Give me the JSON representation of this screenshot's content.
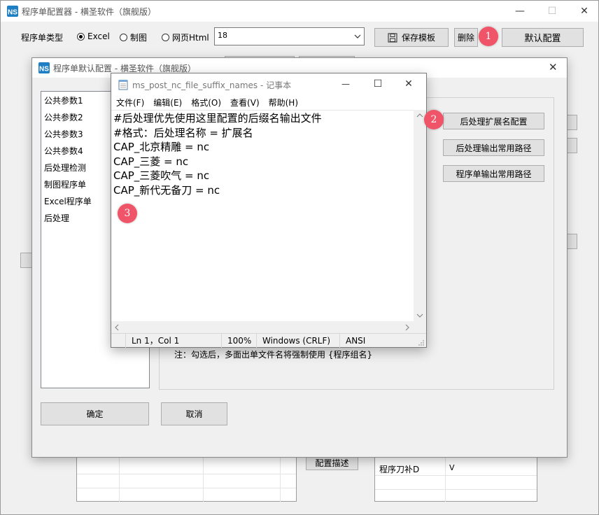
{
  "main_window": {
    "title": "程序单配置器 - 横圣软件（旗舰版）",
    "type_label": "程序单类型",
    "radio_options": [
      {
        "label": "Excel",
        "checked": true
      },
      {
        "label": "制图",
        "checked": false
      },
      {
        "label": "网页Html",
        "checked": false
      }
    ],
    "combo_value": "18",
    "save_template": "保存模板",
    "delete": "删除",
    "default_config": "默认配置",
    "config_desc": "配置描述",
    "table_row_label": "程序刀补D",
    "table_row_value": "V"
  },
  "dialog": {
    "title": "程序单默认配置 - 横圣软件（旗舰版）",
    "left_items": [
      "公共参数1",
      "公共参数2",
      "公共参数3",
      "公共参数4",
      "后处理检测",
      "制图程序单",
      "Excel程序单",
      "后处理"
    ],
    "btn_ext_config": "后处理扩展名配置",
    "btn_output_path": "后处理输出常用路径",
    "btn_sheet_path": "程序单输出常用路径",
    "note": "注：勾选后，多面出单文件名将强制使用 {程序组名}",
    "ok": "确定",
    "cancel": "取消"
  },
  "notepad": {
    "title": "ms_post_nc_file_suffix_names - 记事本",
    "menu": [
      "文件(F)",
      "编辑(E)",
      "格式(O)",
      "查看(V)",
      "帮助(H)"
    ],
    "lines": [
      "#后处理优先使用这里配置的后缀名输出文件",
      "#格式：后处理名称 = 扩展名",
      "CAP_北京精雕 = nc",
      "CAP_三菱 = nc",
      "CAP_三菱吹气 = nc",
      "CAP_新代无备刀 = nc"
    ],
    "status": {
      "position": "Ln 1，Col 1",
      "zoom": "100%",
      "line_ending": "Windows (CRLF)",
      "encoding": "ANSI"
    }
  },
  "badges": [
    "1",
    "2",
    "3"
  ],
  "colors": {
    "badge": "#ef5468",
    "app_logo": "#1e7fc4"
  }
}
